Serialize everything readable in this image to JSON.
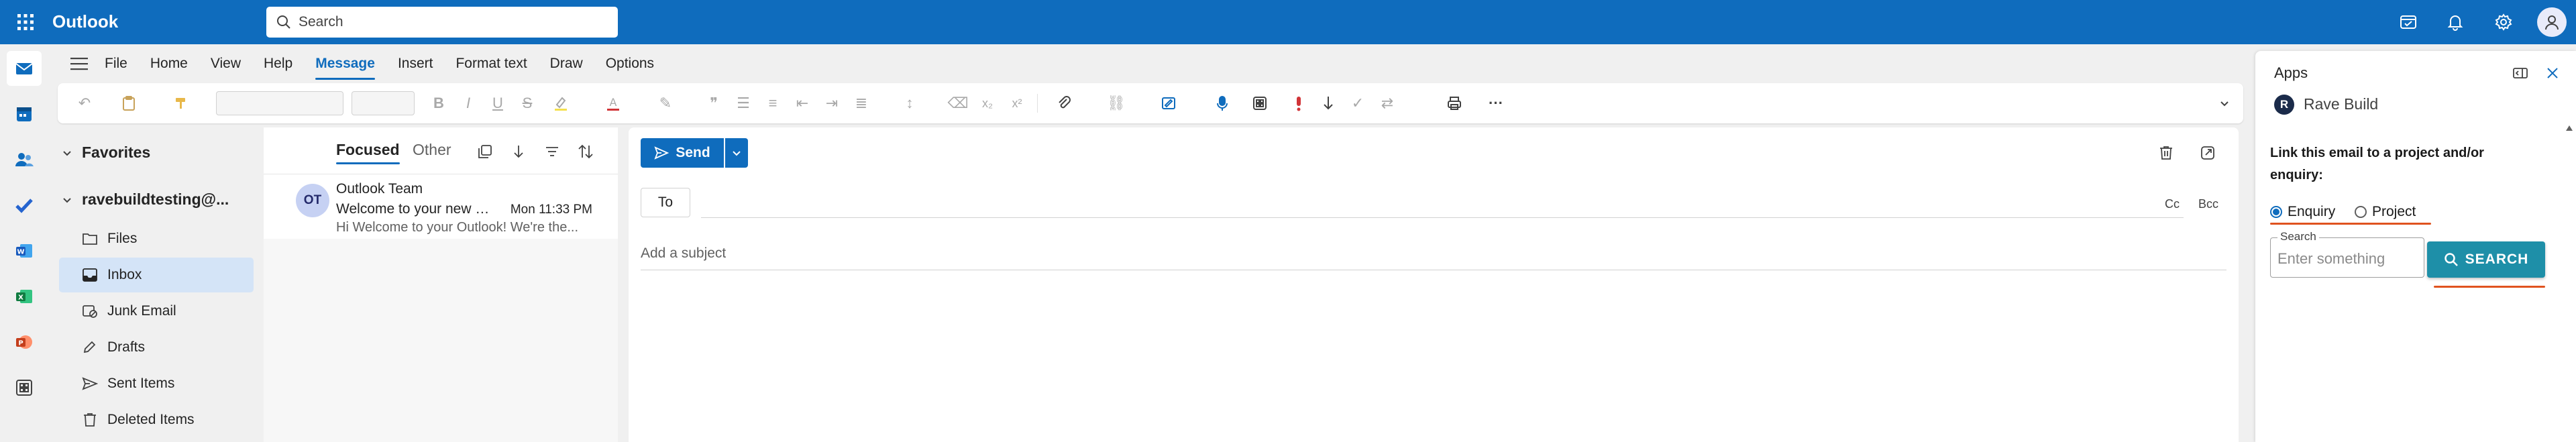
{
  "app": {
    "name": "Outlook",
    "search_placeholder": "Search"
  },
  "colors": {
    "brand_blue": "#0f6cbd",
    "selected_folder": "#d4e4f7",
    "addin_button": "#1e8fa8",
    "highlight_underline": "#e0531f"
  },
  "ribbon": {
    "menus": [
      "File",
      "Home",
      "View",
      "Help",
      "Message",
      "Insert",
      "Format text",
      "Draw",
      "Options"
    ],
    "active_menu": "Message"
  },
  "folders": {
    "favorites_label": "Favorites",
    "account_label": "ravebuildtesting@...",
    "items": [
      {
        "label": "Files",
        "icon": "folder-icon"
      },
      {
        "label": "Inbox",
        "icon": "inbox-icon"
      },
      {
        "label": "Junk Email",
        "icon": "junk-icon"
      },
      {
        "label": "Drafts",
        "icon": "pencil-icon"
      },
      {
        "label": "Sent Items",
        "icon": "send-icon"
      },
      {
        "label": "Deleted Items",
        "icon": "trash-icon"
      }
    ],
    "selected": "Inbox"
  },
  "message_list": {
    "tabs": [
      "Focused",
      "Other"
    ],
    "active_tab": "Focused",
    "messages": [
      {
        "avatar_initials": "OT",
        "sender": "Outlook Team",
        "subject": "Welcome to your new O...",
        "time": "Mon 11:33 PM",
        "preview": "Hi Welcome to your Outlook! We're the..."
      }
    ]
  },
  "compose": {
    "send_label": "Send",
    "to_label": "To",
    "cc_label": "Cc",
    "bcc_label": "Bcc",
    "subject_placeholder": "Add a subject"
  },
  "apps_pane": {
    "title": "Apps",
    "addin_logo": "R",
    "addin_name": "Rave Build",
    "prompt": "Link this email to a project and/or enquiry:",
    "options": [
      "Enquiry",
      "Project"
    ],
    "selected_option": "Enquiry",
    "search_label": "Search",
    "search_placeholder": "Enter something",
    "search_button": "SEARCH"
  }
}
